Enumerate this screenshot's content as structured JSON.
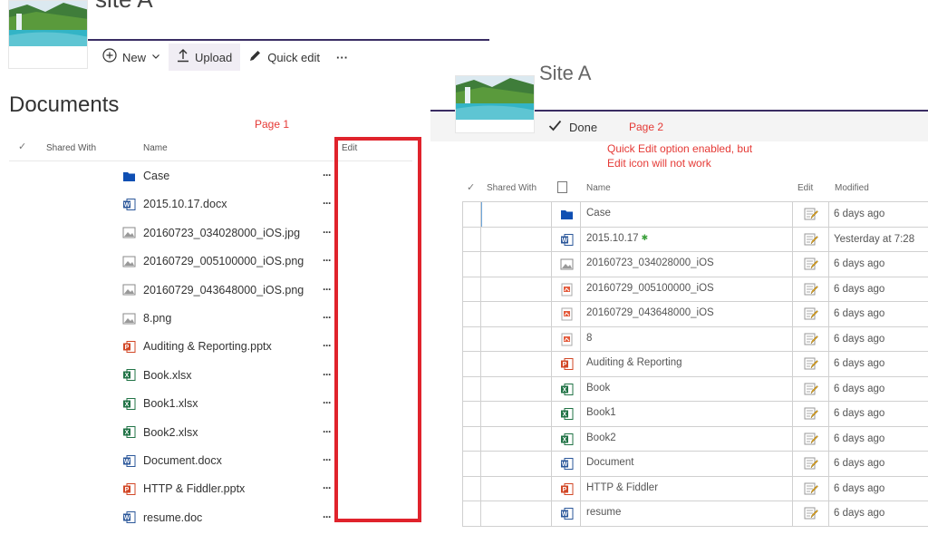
{
  "page1": {
    "site_title": "site A",
    "commands": {
      "new_label": "New",
      "upload_label": "Upload",
      "quick_edit_label": "Quick edit",
      "more_label": "···"
    },
    "doc_title": "Documents",
    "annotation": "Page 1",
    "columns": {
      "shared_with": "Shared With",
      "name": "Name",
      "edit": "Edit"
    },
    "files": [
      {
        "name": "Case",
        "type": "folder"
      },
      {
        "name": "2015.10.17.docx",
        "type": "word"
      },
      {
        "name": "20160723_034028000_iOS.jpg",
        "type": "image"
      },
      {
        "name": "20160729_005100000_iOS.png",
        "type": "image"
      },
      {
        "name": "20160729_043648000_iOS.png",
        "type": "image"
      },
      {
        "name": "8.png",
        "type": "image"
      },
      {
        "name": "Auditing & Reporting.pptx",
        "type": "powerpoint"
      },
      {
        "name": "Book.xlsx",
        "type": "excel"
      },
      {
        "name": "Book1.xlsx",
        "type": "excel"
      },
      {
        "name": "Book2.xlsx",
        "type": "excel"
      },
      {
        "name": "Document.docx",
        "type": "word"
      },
      {
        "name": "HTTP & Fiddler.pptx",
        "type": "powerpoint"
      },
      {
        "name": "resume.doc",
        "type": "word"
      }
    ],
    "more_dots": "···"
  },
  "page2": {
    "site_title_fragment": "Site A",
    "done_label": "Done",
    "annotation": "Page 2",
    "note_line1": "Quick Edit option enabled, but",
    "note_line2": "Edit icon will not work",
    "columns": {
      "shared_with": "Shared With",
      "name": "Name",
      "edit": "Edit",
      "modified": "Modified"
    },
    "rows": [
      {
        "name": "Case",
        "type": "folder",
        "modified": "6 days ago"
      },
      {
        "name": "2015.10.17",
        "type": "word",
        "modified": "Yesterday at 7:28",
        "new": true
      },
      {
        "name": "20160723_034028000_iOS",
        "type": "jpg",
        "modified": "6 days ago"
      },
      {
        "name": "20160729_005100000_iOS",
        "type": "png",
        "modified": "6 days ago"
      },
      {
        "name": "20160729_043648000_iOS",
        "type": "png",
        "modified": "6 days ago"
      },
      {
        "name": "8",
        "type": "png",
        "modified": "6 days ago"
      },
      {
        "name": "Auditing & Reporting",
        "type": "powerpoint",
        "modified": "6 days ago"
      },
      {
        "name": "Book",
        "type": "excel",
        "modified": "6 days ago"
      },
      {
        "name": "Book1",
        "type": "excel",
        "modified": "6 days ago"
      },
      {
        "name": "Book2",
        "type": "excel",
        "modified": "6 days ago"
      },
      {
        "name": "Document",
        "type": "word",
        "modified": "6 days ago"
      },
      {
        "name": "HTTP & Fiddler",
        "type": "powerpoint",
        "modified": "6 days ago"
      },
      {
        "name": "resume",
        "type": "word",
        "modified": "6 days ago"
      }
    ]
  },
  "colors": {
    "suite_rule": "#3a2d63",
    "annotation_red": "#e53935",
    "highlight_box": "#e0232c",
    "folder_blue": "#0f4fb3",
    "word_blue": "#2b579a",
    "excel_green": "#217346",
    "ppt_red": "#d24726"
  }
}
